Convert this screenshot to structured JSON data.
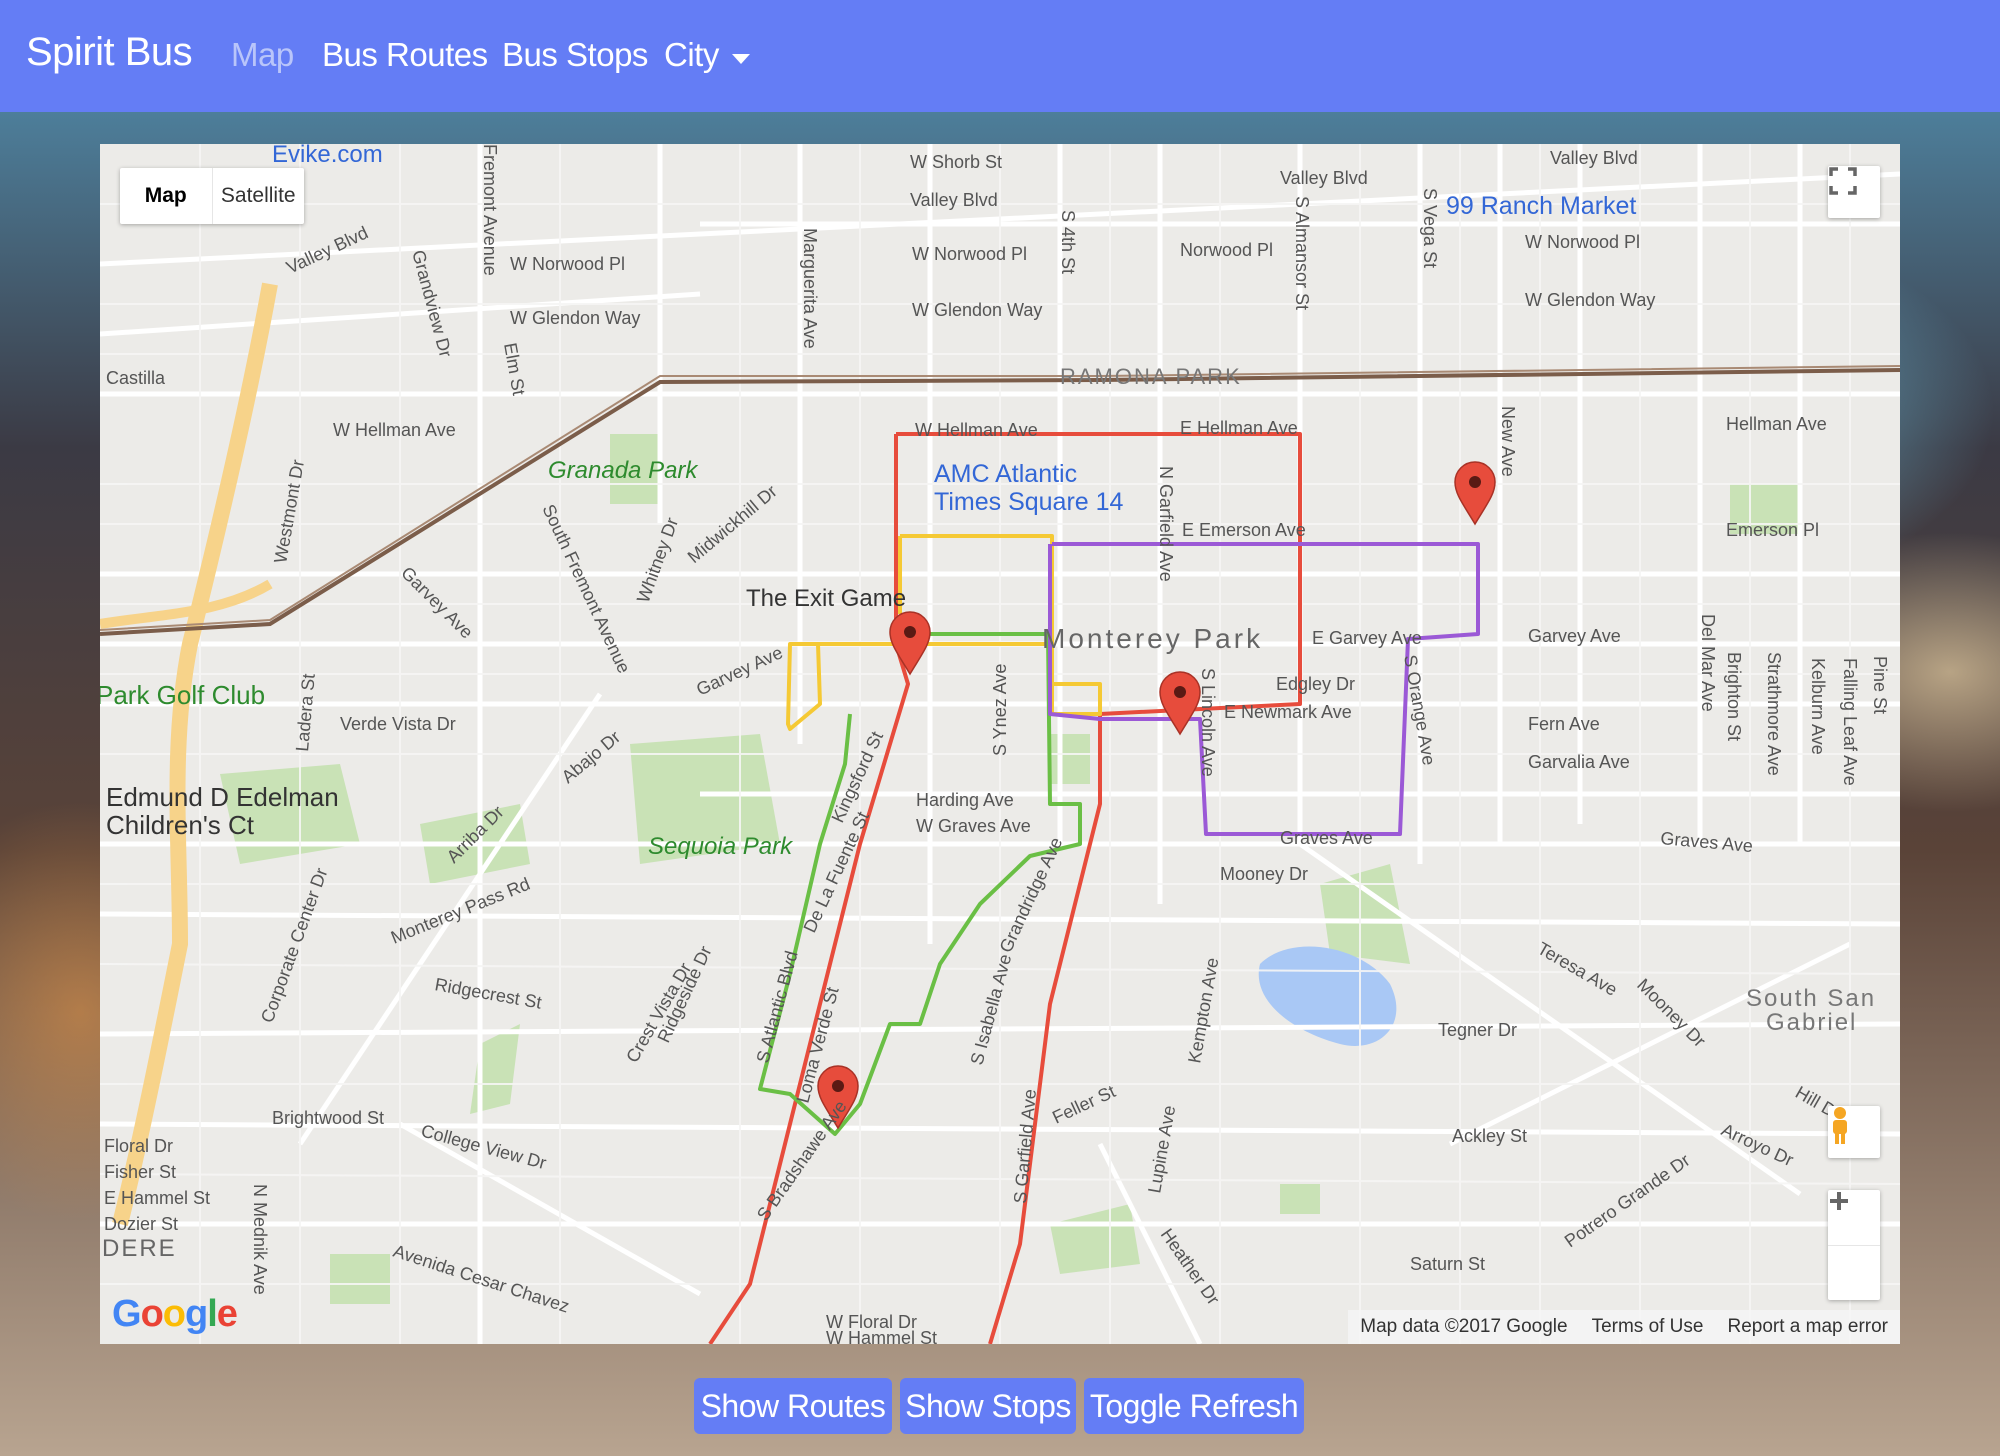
{
  "navbar": {
    "brand": "Spirit Bus",
    "items": [
      {
        "label": "Map",
        "active": true
      },
      {
        "label": "Bus Routes",
        "active": false
      },
      {
        "label": "Bus Stops",
        "active": false
      },
      {
        "label": "City",
        "active": false,
        "dropdown": true
      }
    ],
    "background_color": "#647df5"
  },
  "map": {
    "map_type_controls": [
      {
        "label": "Map",
        "selected": true
      },
      {
        "label": "Satellite",
        "selected": false
      }
    ],
    "fullscreen_icon": "fullscreen-icon",
    "pegman_icon": "pegman-icon",
    "zoom_in_icon": "zoom-in-icon",
    "zoom_out_icon": "zoom-out-icon",
    "attribution": "Map data ©2017 Google",
    "terms": "Terms of Use",
    "report": "Report a map error",
    "logo": "Google",
    "street_labels": [
      "Evike.com",
      "W Shorb St",
      "Valley Blvd",
      "Valley Blvd",
      "Valley Blvd",
      "Valley Blvd",
      "99 Ranch Market",
      "W Norwood Pl",
      "Norwood Pl",
      "W Norwood Pl",
      "W Norwood Pl",
      "W Glendon Way",
      "W Glendon Way",
      "W Glendon Way",
      "RAMONA PARK",
      "Castilla",
      "W Hellman Ave",
      "W Hellman Ave",
      "E Hellman Ave",
      "Hellman Ave",
      "Granada Park",
      "AMC Atlantic",
      "Times Square 14",
      "E Emerson Ave",
      "Emerson Pl",
      "The Exit Game",
      "Monterey Park",
      "E Garvey Ave",
      "Garvey Ave",
      "Garvey Ave",
      "Garvey Ave",
      "Park Golf Club",
      "Verde Vista Dr",
      "Edmund D Edelman",
      "Children's Ct",
      "Edgley Dr",
      "E Newmark Ave",
      "Fern Ave",
      "Garvalia Ave",
      "Harding Ave",
      "W Graves Ave",
      "Graves Ave",
      "Graves Ave",
      "Sequoia Park",
      "Mooney Dr",
      "Monterey Pass Rd",
      "Ridgecrest St",
      "South San",
      "Gabriel",
      "Tegner Dr",
      "Teresa Ave",
      "Mooney Dr",
      "Hill Dr",
      "Arroyo Dr",
      "Ackley St",
      "Brightwood St",
      "College View Dr",
      "Floral Dr",
      "Fisher St",
      "E Hammel St",
      "Dozier St",
      "DERE",
      "Avenida Cesar Chavez",
      "Saturn St",
      "Potrero Grande Dr",
      "W Floral Dr",
      "W Hammel St",
      "Feller St",
      "Heather Dr",
      "Lupine Ave",
      "Kempton Ave",
      "Grandridge Ave",
      "S Isabella Ave",
      "S Ynez Ave",
      "Kingsford St",
      "De La Fuente St",
      "Loma Verde St",
      "S Bradshawe Ave",
      "Whitney Dr",
      "Midwickhill Dr",
      "South Fremont Avenue",
      "Garvey Ave",
      "Abajo Dr",
      "Arriba Dr",
      "Ladera St",
      "Westmont Dr",
      "Grandview Dr",
      "Elm St",
      "Fremont Avenue",
      "Marguerita Ave",
      "S 4th St",
      "S Almansor St",
      "S Vega St",
      "New Ave",
      "Del Mar Ave",
      "N Garfield Ave",
      "S Orange Ave",
      "Brighton St",
      "Strathmore Ave",
      "Kelburn Ave",
      "Falling Leaf Ave",
      "Corporate Center Dr",
      "Crest Vista Dr",
      "Ridgeside Dr",
      "N Mednik Ave",
      "S Garfield Ave",
      "S Atlantic Blvd",
      "S Lincoln Ave",
      "Pine St"
    ],
    "routes": [
      {
        "color": "#e74c3c",
        "name": ""
      },
      {
        "color": "#f5c934",
        "name": ""
      },
      {
        "color": "#6abf45",
        "name": ""
      },
      {
        "color": "#9b59d6",
        "name": ""
      }
    ],
    "markers": 4
  },
  "actions": {
    "show_routes": "Show Routes",
    "show_stops": "Show Stops",
    "toggle_refresh": "Toggle Refresh"
  }
}
